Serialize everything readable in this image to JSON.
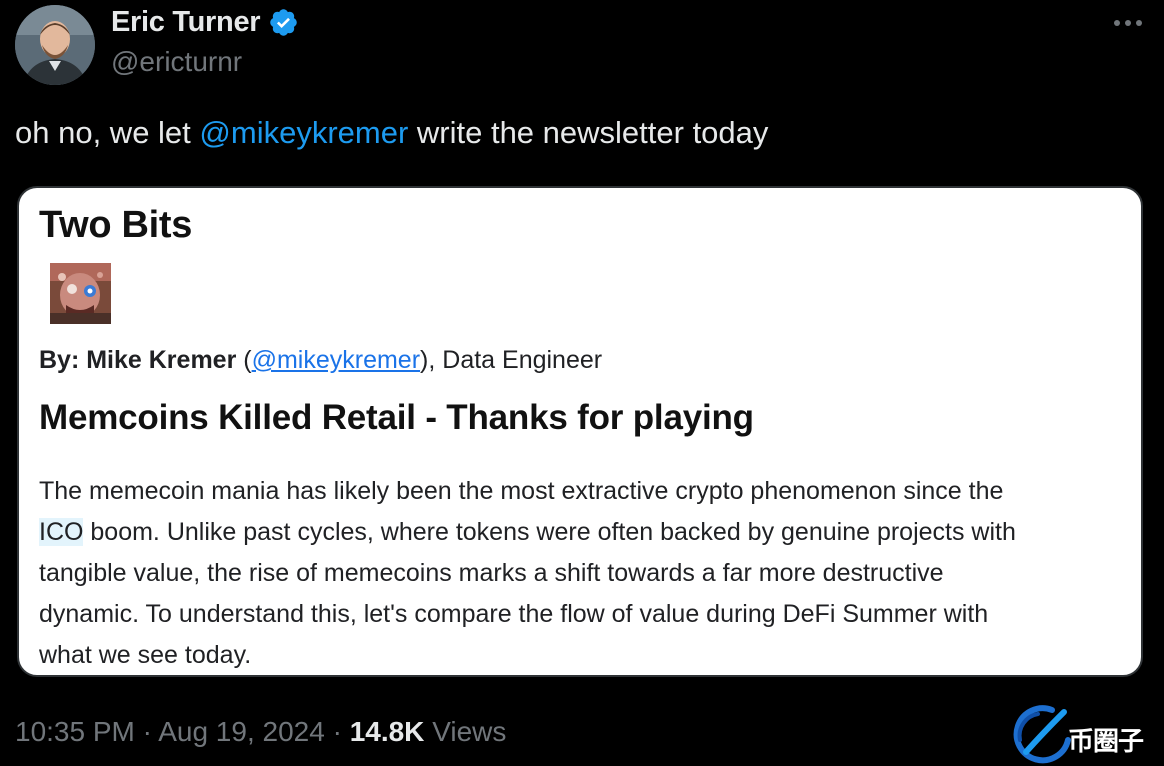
{
  "tweet": {
    "author": {
      "display_name": "Eric Turner",
      "handle": "@ericturnr",
      "verified": true
    },
    "text": {
      "before": "oh no, we let ",
      "mention": "@mikeykremer",
      "after": " write the newsletter today"
    },
    "timestamp": {
      "time": "10:35 PM",
      "date": "Aug 19, 2024",
      "views_count": "14.8K",
      "views_label": "Views"
    }
  },
  "newsletter": {
    "title": "Two Bits",
    "byline": {
      "prefix": "By: Mike Kremer",
      "open_paren": " (",
      "handle": "@mikeykremer",
      "close_and_role": "), Data Engineer"
    },
    "headline": "Memcoins Killed Retail - Thanks for playing",
    "body": {
      "line1": "The memecoin mania has likely been the most extractive crypto phenomenon since the",
      "line2_highlight": "ICO",
      "line2_rest": " boom. Unlike past cycles, where tokens were often backed by genuine projects with",
      "line3": "tangible value, the rise of memecoins marks a shift towards a far more destructive",
      "line4": "dynamic. To understand this, let's compare the flow of value during DeFi Summer with",
      "line5": "what we see today."
    }
  },
  "watermark": {
    "text": "币圈子"
  },
  "colors": {
    "background": "#000000",
    "accent": "#1d9bf0",
    "secondary_text": "#71767b",
    "primary_text": "#e7e9ea"
  },
  "icons": {
    "verified": "verified-badge-icon",
    "more": "more-horizontal-icon"
  }
}
